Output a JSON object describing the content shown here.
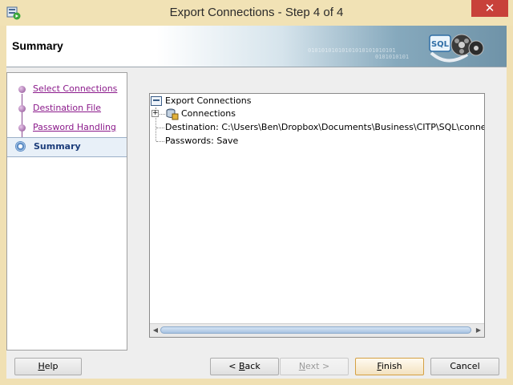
{
  "window": {
    "title": "Export Connections - Step 4 of 4",
    "close_glyph": "✕",
    "app_icon": "connections-app-icon"
  },
  "banner": {
    "title": "Summary",
    "binary_text": "01010101010101010101010101",
    "binary_text2": "0101010101",
    "art_label": "SQL"
  },
  "steps": {
    "items": [
      {
        "label": "Select Connections"
      },
      {
        "label": "Destination File"
      },
      {
        "label": "Password Handling"
      },
      {
        "label": "Summary"
      }
    ],
    "current": "Summary"
  },
  "tree": {
    "root_label": "Export Connections",
    "connections_label": "Connections",
    "expand_glyph": "+",
    "destination_label": "Destination: C:\\Users\\Ben\\Dropbox\\Documents\\Business\\CITP\\SQL\\connections_bl",
    "passwords_label": "Passwords: Save",
    "scroll_left": "◀",
    "scroll_right": "▶"
  },
  "buttons": {
    "help": {
      "label": "Help",
      "mnemonic": "H",
      "rest": "elp"
    },
    "back": {
      "label": "< Back",
      "prefix": "< ",
      "mnemonic": "B",
      "rest": "ack"
    },
    "next": {
      "label": "Next >",
      "mnemonic": "N",
      "rest": "ext >"
    },
    "finish": {
      "label": "Finish",
      "mnemonic": "F",
      "rest": "inish"
    },
    "cancel": {
      "label": "Cancel"
    }
  },
  "colors": {
    "frame": "#f0e0b3",
    "close": "#c8413a",
    "link": "#8b1a8b",
    "current_step": "#1c3d7a"
  }
}
